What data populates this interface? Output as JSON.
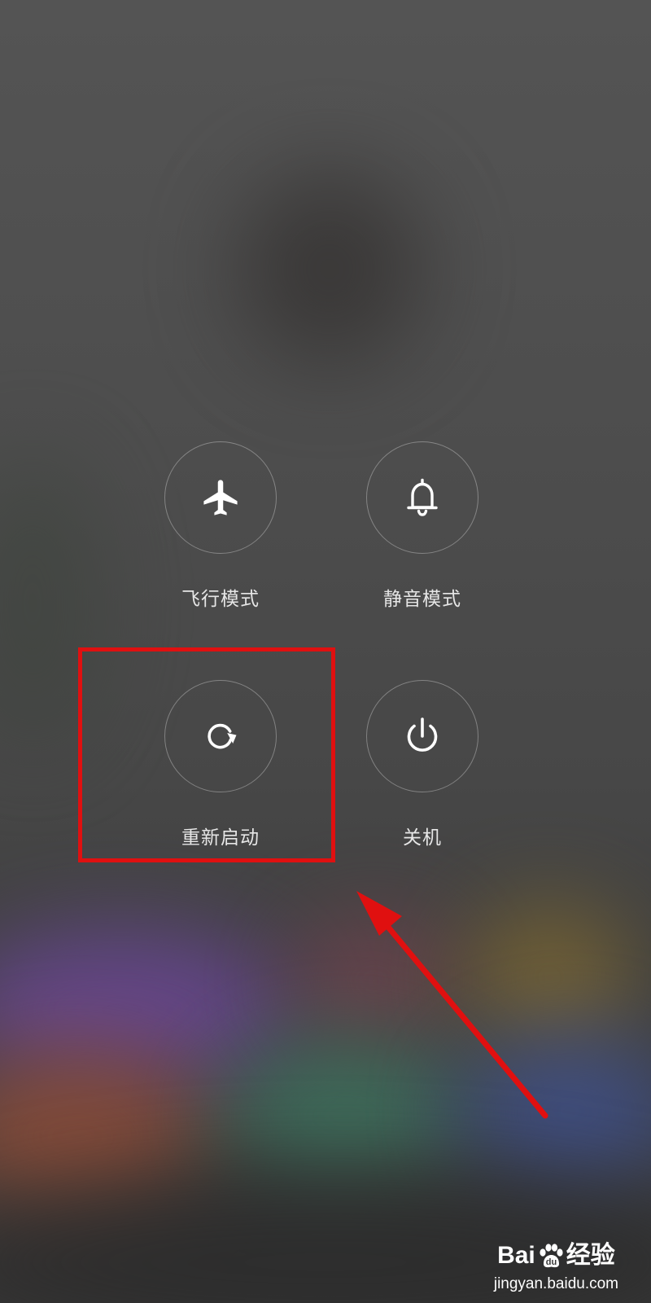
{
  "power_menu": {
    "actions": [
      {
        "id": "airplane",
        "label": "飞行模式",
        "icon": "airplane-icon"
      },
      {
        "id": "silent",
        "label": "静音模式",
        "icon": "bell-icon"
      },
      {
        "id": "restart",
        "label": "重新启动",
        "icon": "restart-icon"
      },
      {
        "id": "power",
        "label": "关机",
        "icon": "power-icon"
      }
    ]
  },
  "annotation": {
    "highlight_target": "restart",
    "color": "#e01010"
  },
  "watermark": {
    "brand_prefix": "Bai",
    "brand_suffix": "经验",
    "url": "jingyan.baidu.com"
  }
}
